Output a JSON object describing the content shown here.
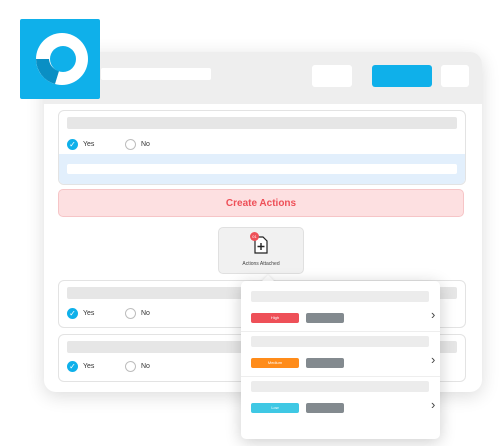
{
  "options": {
    "yes": "Yes",
    "no": "No"
  },
  "create_actions_label": "Create Actions",
  "attachment": {
    "label": "Actions Attached",
    "badge": "01"
  },
  "popup_items": [
    {
      "priority": "High",
      "color": "#ee5058"
    },
    {
      "priority": "Medium",
      "color": "#ff8c1a"
    },
    {
      "priority": "Low",
      "color": "#3fc8e4"
    }
  ],
  "accent_color": "#0fb0ea",
  "icons": [
    "logo-icon",
    "check-icon",
    "file-plus-icon",
    "chevron-right-icon"
  ]
}
